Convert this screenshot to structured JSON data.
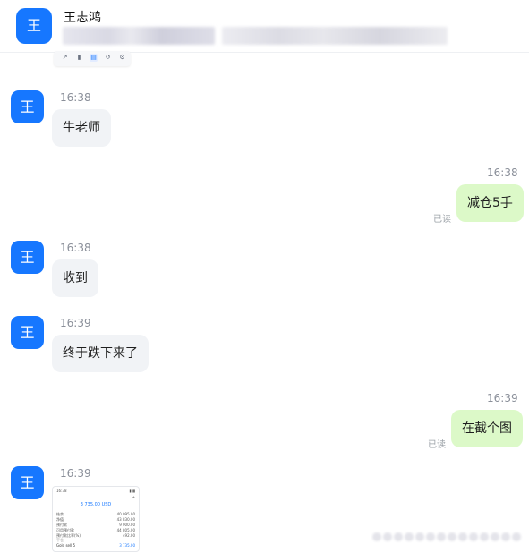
{
  "header": {
    "avatar_text": "王",
    "contact_name": "王志鸿"
  },
  "toolbar": {
    "icons": [
      "share-icon",
      "bookmark-icon",
      "document-icon",
      "history-icon",
      "settings-icon"
    ]
  },
  "messages": [
    {
      "side": "in",
      "time": "16:38",
      "avatar_text": "王",
      "text": "牛老师"
    },
    {
      "side": "out",
      "time": "16:38",
      "text": "减仓5手",
      "read_label": "已读"
    },
    {
      "side": "in",
      "time": "16:38",
      "avatar_text": "王",
      "text": "收到"
    },
    {
      "side": "in",
      "time": "16:39",
      "avatar_text": "王",
      "text": "终于跌下来了"
    },
    {
      "side": "out",
      "time": "16:39",
      "text": "在截个图",
      "read_label": "已读"
    },
    {
      "side": "in",
      "time": "16:39",
      "avatar_text": "王",
      "type": "image"
    }
  ],
  "thumbnail": {
    "top_left": "16:38",
    "balance": "3 735.00 USD",
    "rows": [
      {
        "label": "结余",
        "value": "40 095.00"
      },
      {
        "label": "净值",
        "value": "43 830.00"
      },
      {
        "label": "预付款",
        "value": "9 000.00"
      },
      {
        "label": "可用预付款",
        "value": "44 805.00"
      },
      {
        "label": "预付款比率(%)",
        "value": "492.00"
      }
    ],
    "section": "平仓",
    "footer_left": "Gold sell 5",
    "footer_value": "3 735.00"
  },
  "colors": {
    "accent": "#1677ff",
    "outgoing_bubble": "#dcf9c8",
    "incoming_bubble": "#f1f3f6"
  }
}
